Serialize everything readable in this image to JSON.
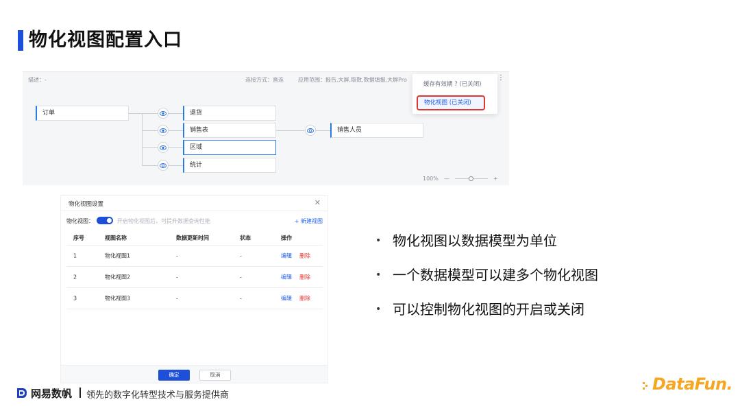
{
  "slide": {
    "title": "物化视图配置入口"
  },
  "canvas": {
    "desc": "描述：-",
    "connection": "连接方式：直连",
    "scope": "应用范围：报告,大屏,取数,数据填报,大屏Pro",
    "nodes": {
      "order": "订单",
      "return": "退货",
      "sales_table": "销售表",
      "region": "区域",
      "stats": "统计",
      "sales_person": "销售人员"
    },
    "dropdown": {
      "cache": "缓存有效期 ? (已关闭)",
      "mview": "物化视图 (已关闭)"
    },
    "more": "⋮",
    "zoom": {
      "level": "100%",
      "minus": "—",
      "plus": "+"
    }
  },
  "dialog": {
    "title": "物化视图设置",
    "close": "✕",
    "toggle_label": "物化视图：",
    "toggle_on": true,
    "toggle_hint": "开启物化视图后，可提升数据查询性能",
    "new_view": "+ 新建视图",
    "columns": [
      "序号",
      "视图名称",
      "数据更新时间",
      "状态",
      "操作"
    ],
    "rows": [
      {
        "no": "1",
        "name": "物化视图1",
        "updated": "-",
        "status": "-",
        "edit": "编辑",
        "delete": "删除"
      },
      {
        "no": "2",
        "name": "物化视图2",
        "updated": "-",
        "status": "-",
        "edit": "编辑",
        "delete": "删除"
      },
      {
        "no": "3",
        "name": "物化视图3",
        "updated": "-",
        "status": "-",
        "edit": "编辑",
        "delete": "删除"
      }
    ],
    "ok": "确定",
    "cancel": "取消"
  },
  "bullets": [
    "物化视图以数据模型为单位",
    "一个数据模型可以建多个物化视图",
    "可以控制物化视图的开启或关闭"
  ],
  "footer": {
    "brand": "网易数帆",
    "tagline": "领先的数字化转型技术与服务提供商",
    "partner_logo": "DataFun."
  },
  "colors": {
    "accent": "#1d4fd8",
    "link": "#2563eb",
    "danger": "#e0362c",
    "datafun": "#f5a623"
  }
}
